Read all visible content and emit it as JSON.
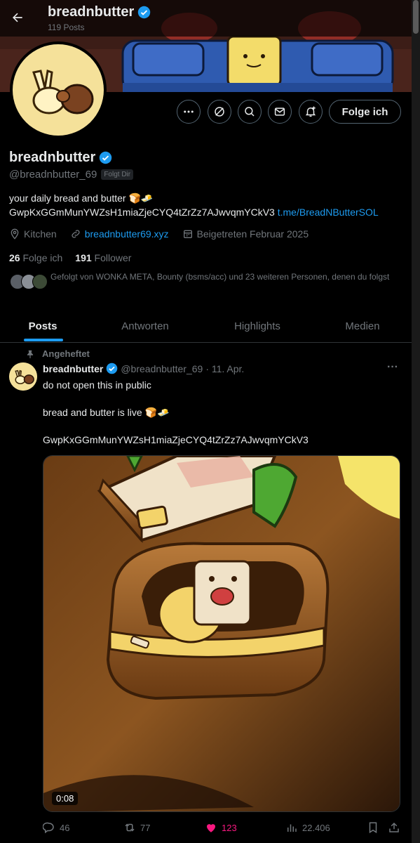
{
  "header": {
    "name": "breadnbutter",
    "post_count": "119 Posts"
  },
  "profile": {
    "display_name": "breadnbutter",
    "handle": "@breadnbutter_69",
    "follows_you": "Folgt Dir",
    "bio_line1": "your daily bread and butter",
    "bio_emoji": "🍞🧈",
    "contract": "GwpKxGGmMunYWZsH1miaZjeCYQ4tZrZz7AJwvqmYCkV3",
    "bio_link": "t.me/BreadNButterSOL",
    "location": "Kitchen",
    "website": "breadnbutter69.xyz",
    "joined": "Beigetreten Februar 2025",
    "following_count": "26",
    "following_label": "Folge ich",
    "followers_count": "191",
    "followers_label": "Follower",
    "followed_by": "Gefolgt von WONKA META, Bounty (bsms/acc) und 23 weiteren Personen, denen du folgst"
  },
  "buttons": {
    "follow": "Folge ich"
  },
  "tabs": [
    "Posts",
    "Antworten",
    "Highlights",
    "Medien"
  ],
  "post": {
    "pinned_label": "Angeheftet",
    "author": "breadnbutter",
    "handle": "@breadnbutter_69",
    "date": "· 11. Apr.",
    "more": "···",
    "line1": "do not open this in public",
    "line2": "bread and butter is live 🍞🧈",
    "line3": "GwpKxGGmMunYWZsH1miaZjeCYQ4tZrZz7AJwvqmYCkV3",
    "video_time": "0:08",
    "replies": "46",
    "reposts": "77",
    "likes": "123",
    "views": "22.406"
  },
  "colors": {
    "accent": "#1d9bf0",
    "like": "#f91880",
    "muted": "#71767b",
    "background": "#000000"
  }
}
